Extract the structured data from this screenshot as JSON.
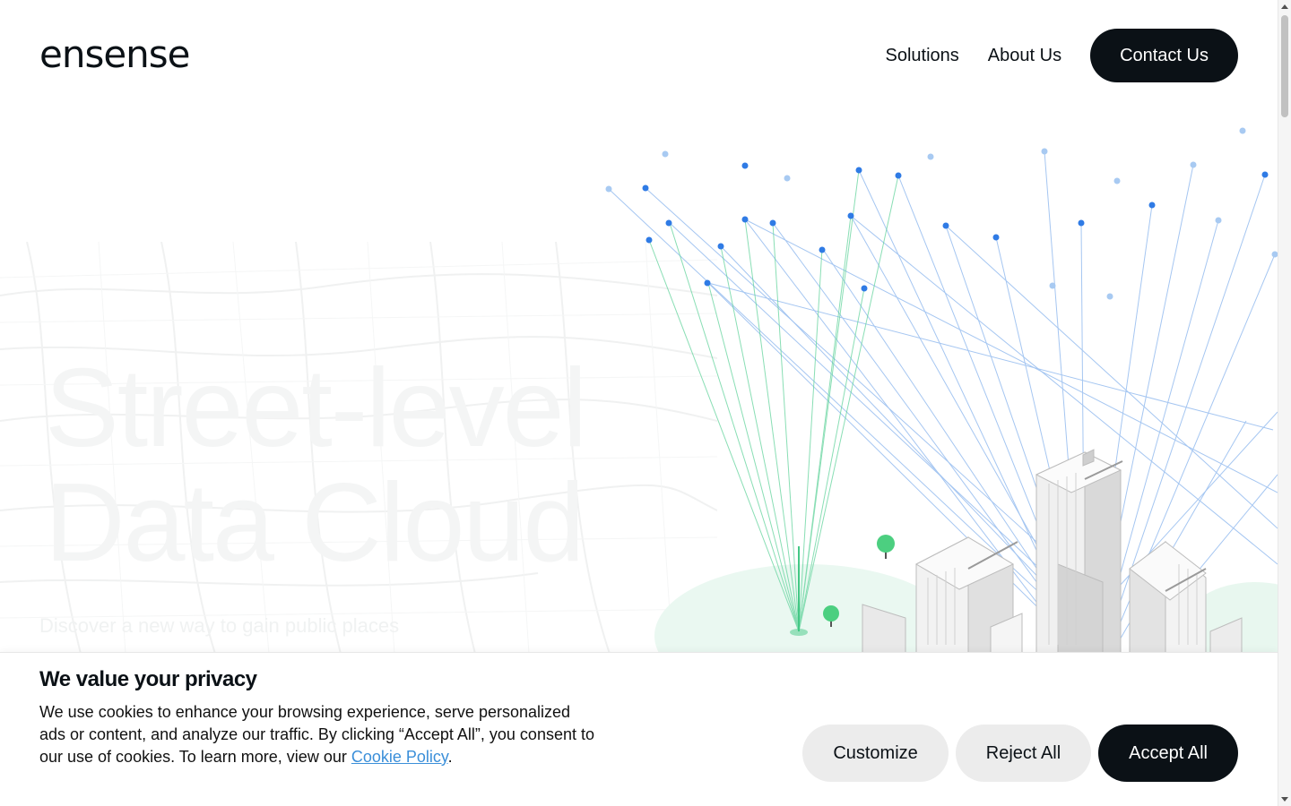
{
  "header": {
    "logo_text": "ensense",
    "nav": {
      "solutions": "Solutions",
      "about": "About Us",
      "contact": "Contact Us"
    }
  },
  "hero": {
    "title_line1": "Street-level",
    "title_line2": "Data Cloud",
    "subtitle": "Discover a new way to gain public places"
  },
  "cookie_banner": {
    "title": "We value your privacy",
    "text": "We use cookies to enhance your browsing experience, serve personalized ads or content, and analyze our traffic. By clicking “Accept All”, you consent to our use of cookies. To learn more, view our ",
    "link_text": "Cookie Policy",
    "text_end": ".",
    "buttons": {
      "customize": "Customize",
      "reject": "Reject All",
      "accept": "Accept All"
    }
  },
  "colors": {
    "primary_dark": "#0b1116",
    "button_light": "#ececec",
    "link": "#3b8fd9",
    "dot_blue": "#2f7be5",
    "line_green": "#43c885"
  }
}
